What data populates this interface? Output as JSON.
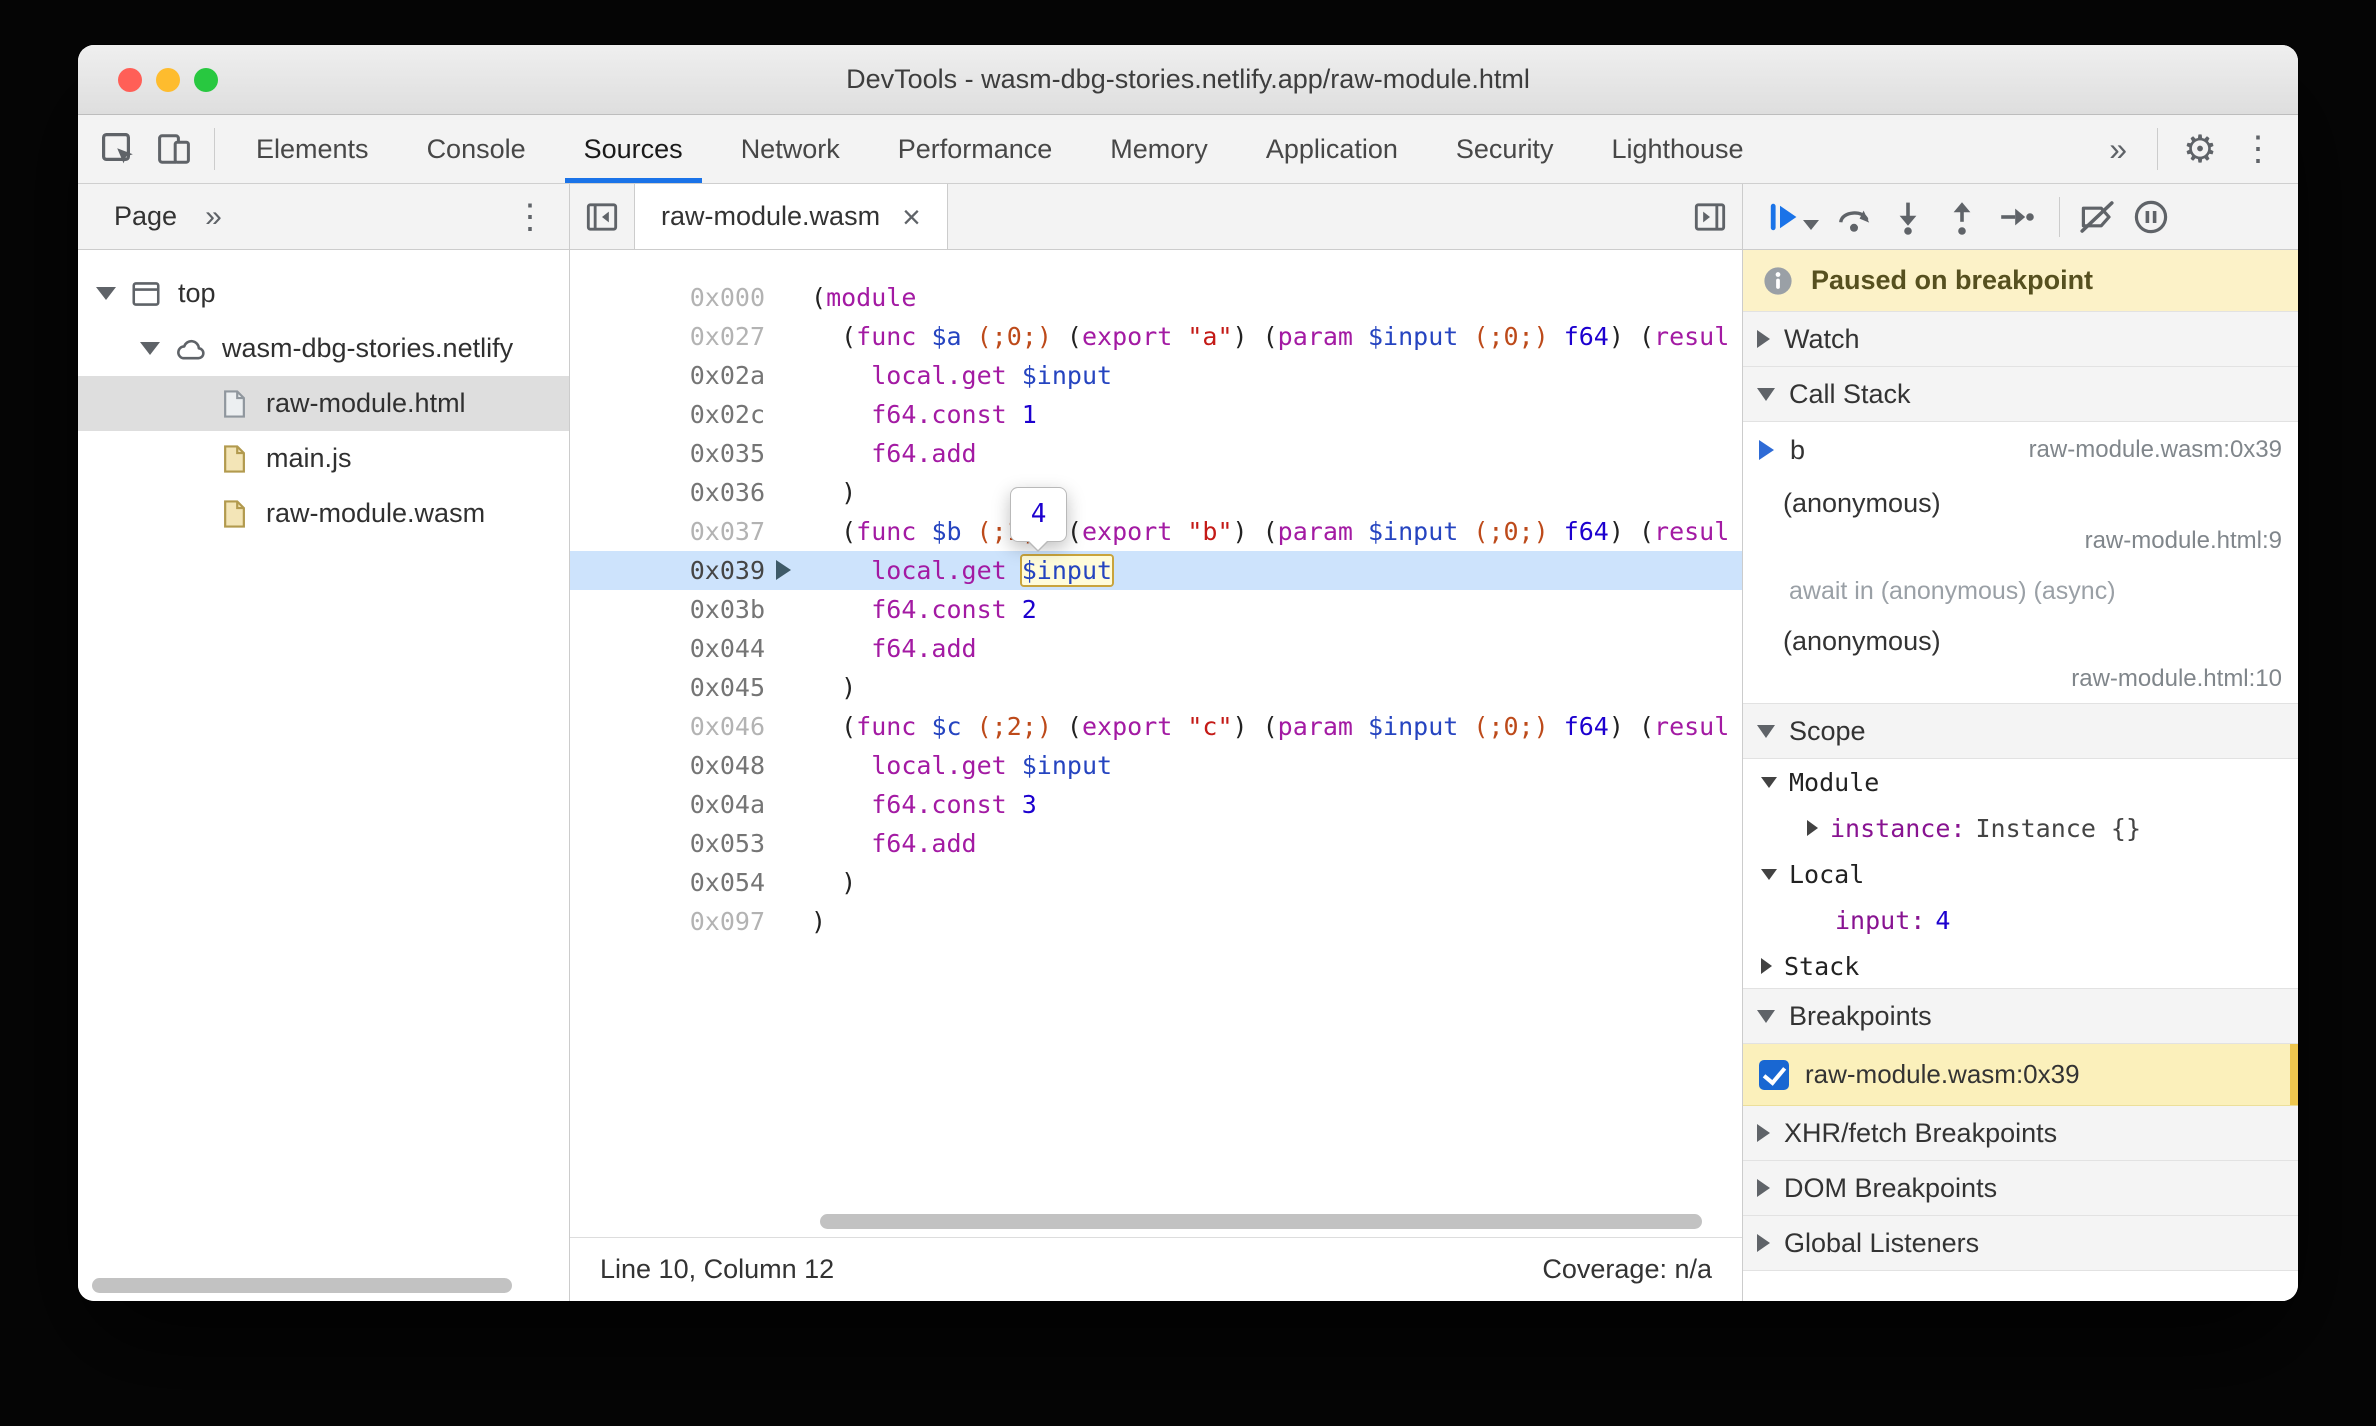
{
  "window": {
    "title": "DevTools - wasm-dbg-stories.netlify.app/raw-module.html",
    "traffic_lights": [
      "#ff5f57",
      "#febc2e",
      "#28c840"
    ]
  },
  "icon_glyphs": {
    "gear": "⚙",
    "kebab": "⋮"
  },
  "colors": {
    "accent": "#1a73e8",
    "current_line": "#cde3fc",
    "paused_banner": "#fcf2c8",
    "breakpoint_row": "#fbf0bb"
  },
  "main_toolbar": {
    "tabs": [
      {
        "label": "Elements",
        "active": false
      },
      {
        "label": "Console",
        "active": false
      },
      {
        "label": "Sources",
        "active": true
      },
      {
        "label": "Network",
        "active": false
      },
      {
        "label": "Performance",
        "active": false
      },
      {
        "label": "Memory",
        "active": false
      },
      {
        "label": "Application",
        "active": false
      },
      {
        "label": "Security",
        "active": false
      },
      {
        "label": "Lighthouse",
        "active": false
      }
    ],
    "more_tabs_label": "»"
  },
  "navigator": {
    "tab_label": "Page",
    "more_label": "»",
    "tree": [
      {
        "label": "top",
        "icon": "frame",
        "depth": 0,
        "expanded": true,
        "selected": false
      },
      {
        "label": "wasm-dbg-stories.netlify",
        "icon": "cloud",
        "depth": 1,
        "expanded": true,
        "selected": false
      },
      {
        "label": "raw-module.html",
        "icon": "doc-html",
        "depth": 2,
        "selected": true
      },
      {
        "label": "main.js",
        "icon": "doc-script",
        "depth": 2,
        "selected": false
      },
      {
        "label": "raw-module.wasm",
        "icon": "doc-script",
        "depth": 2,
        "selected": false
      }
    ]
  },
  "editor": {
    "tab_label": "raw-module.wasm",
    "close_label": "×",
    "tooltip_value": "4",
    "status_left": "Line 10, Column 12",
    "status_right": "Coverage: n/a",
    "lines": [
      {
        "addr": "0x000",
        "dim": true,
        "tokens": [
          {
            "t": "(",
            "c": "pl"
          },
          {
            "t": "module",
            "c": "kw"
          }
        ]
      },
      {
        "addr": "0x027",
        "dim": true,
        "tokens": [
          {
            "t": "  (",
            "c": "pl"
          },
          {
            "t": "func",
            "c": "kw"
          },
          {
            "t": " ",
            "c": "pl"
          },
          {
            "t": "$a",
            "c": "var"
          },
          {
            "t": " ",
            "c": "pl"
          },
          {
            "t": "(;0;)",
            "c": "cmt"
          },
          {
            "t": " (",
            "c": "pl"
          },
          {
            "t": "export",
            "c": "kw"
          },
          {
            "t": " ",
            "c": "pl"
          },
          {
            "t": "\"a\"",
            "c": "str"
          },
          {
            "t": ") (",
            "c": "pl"
          },
          {
            "t": "param",
            "c": "kw"
          },
          {
            "t": " ",
            "c": "pl"
          },
          {
            "t": "$input",
            "c": "var"
          },
          {
            "t": " ",
            "c": "pl"
          },
          {
            "t": "(;0;)",
            "c": "cmt"
          },
          {
            "t": " ",
            "c": "pl"
          },
          {
            "t": "f64",
            "c": "typ"
          },
          {
            "t": ") (",
            "c": "pl"
          },
          {
            "t": "resul",
            "c": "kw"
          }
        ]
      },
      {
        "addr": "0x02a",
        "tokens": [
          {
            "t": "    ",
            "c": "pl"
          },
          {
            "t": "local.get",
            "c": "kw"
          },
          {
            "t": " ",
            "c": "pl"
          },
          {
            "t": "$input",
            "c": "var"
          }
        ]
      },
      {
        "addr": "0x02c",
        "tokens": [
          {
            "t": "    ",
            "c": "pl"
          },
          {
            "t": "f64.const",
            "c": "kw"
          },
          {
            "t": " ",
            "c": "pl"
          },
          {
            "t": "1",
            "c": "num"
          }
        ]
      },
      {
        "addr": "0x035",
        "tokens": [
          {
            "t": "    ",
            "c": "pl"
          },
          {
            "t": "f64.add",
            "c": "kw"
          }
        ]
      },
      {
        "addr": "0x036",
        "tokens": [
          {
            "t": "  )",
            "c": "pl"
          }
        ]
      },
      {
        "addr": "0x037",
        "dim": true,
        "tokens": [
          {
            "t": "  (",
            "c": "pl"
          },
          {
            "t": "func",
            "c": "kw"
          },
          {
            "t": " ",
            "c": "pl"
          },
          {
            "t": "$b",
            "c": "var"
          },
          {
            "t": " ",
            "c": "pl"
          },
          {
            "t": "(;1;)",
            "c": "cmt"
          },
          {
            "t": " (",
            "c": "pl"
          },
          {
            "t": "export",
            "c": "kw"
          },
          {
            "t": " ",
            "c": "pl"
          },
          {
            "t": "\"b\"",
            "c": "str"
          },
          {
            "t": ") (",
            "c": "pl"
          },
          {
            "t": "param",
            "c": "kw"
          },
          {
            "t": " ",
            "c": "pl"
          },
          {
            "t": "$input",
            "c": "var"
          },
          {
            "t": " ",
            "c": "pl"
          },
          {
            "t": "(;0;)",
            "c": "cmt"
          },
          {
            "t": " ",
            "c": "pl"
          },
          {
            "t": "f64",
            "c": "typ"
          },
          {
            "t": ") (",
            "c": "pl"
          },
          {
            "t": "resul",
            "c": "kw"
          }
        ]
      },
      {
        "addr": "0x039",
        "current": true,
        "tokens": [
          {
            "t": "    ",
            "c": "pl"
          },
          {
            "t": "local.get",
            "c": "kw"
          },
          {
            "t": " ",
            "c": "pl"
          },
          {
            "t": "$input",
            "c": "var",
            "boxed": true
          }
        ]
      },
      {
        "addr": "0x03b",
        "tokens": [
          {
            "t": "    ",
            "c": "pl"
          },
          {
            "t": "f64.const",
            "c": "kw"
          },
          {
            "t": " ",
            "c": "pl"
          },
          {
            "t": "2",
            "c": "num"
          }
        ]
      },
      {
        "addr": "0x044",
        "tokens": [
          {
            "t": "    ",
            "c": "pl"
          },
          {
            "t": "f64.add",
            "c": "kw"
          }
        ]
      },
      {
        "addr": "0x045",
        "tokens": [
          {
            "t": "  )",
            "c": "pl"
          }
        ]
      },
      {
        "addr": "0x046",
        "dim": true,
        "tokens": [
          {
            "t": "  (",
            "c": "pl"
          },
          {
            "t": "func",
            "c": "kw"
          },
          {
            "t": " ",
            "c": "pl"
          },
          {
            "t": "$c",
            "c": "var"
          },
          {
            "t": " ",
            "c": "pl"
          },
          {
            "t": "(;2;)",
            "c": "cmt"
          },
          {
            "t": " (",
            "c": "pl"
          },
          {
            "t": "export",
            "c": "kw"
          },
          {
            "t": " ",
            "c": "pl"
          },
          {
            "t": "\"c\"",
            "c": "str"
          },
          {
            "t": ") (",
            "c": "pl"
          },
          {
            "t": "param",
            "c": "kw"
          },
          {
            "t": " ",
            "c": "pl"
          },
          {
            "t": "$input",
            "c": "var"
          },
          {
            "t": " ",
            "c": "pl"
          },
          {
            "t": "(;0;)",
            "c": "cmt"
          },
          {
            "t": " ",
            "c": "pl"
          },
          {
            "t": "f64",
            "c": "typ"
          },
          {
            "t": ") (",
            "c": "pl"
          },
          {
            "t": "resul",
            "c": "kw"
          }
        ]
      },
      {
        "addr": "0x048",
        "tokens": [
          {
            "t": "    ",
            "c": "pl"
          },
          {
            "t": "local.get",
            "c": "kw"
          },
          {
            "t": " ",
            "c": "pl"
          },
          {
            "t": "$input",
            "c": "var"
          }
        ]
      },
      {
        "addr": "0x04a",
        "tokens": [
          {
            "t": "    ",
            "c": "pl"
          },
          {
            "t": "f64.const",
            "c": "kw"
          },
          {
            "t": " ",
            "c": "pl"
          },
          {
            "t": "3",
            "c": "num"
          }
        ]
      },
      {
        "addr": "0x053",
        "tokens": [
          {
            "t": "    ",
            "c": "pl"
          },
          {
            "t": "f64.add",
            "c": "kw"
          }
        ]
      },
      {
        "addr": "0x054",
        "tokens": [
          {
            "t": "  )",
            "c": "pl"
          }
        ]
      },
      {
        "addr": "0x097",
        "dim": true,
        "tokens": [
          {
            "t": ")",
            "c": "pl"
          }
        ]
      }
    ]
  },
  "debugger": {
    "paused_message": "Paused on breakpoint",
    "watch_label": "Watch",
    "call_stack": {
      "label": "Call Stack",
      "frames": [
        {
          "name": "b",
          "location": "raw-module.wasm:0x39",
          "current": true
        },
        {
          "name": "(anonymous)",
          "location": "raw-module.html:9"
        },
        {
          "name": "(anonymous)",
          "location": "raw-module.html:10"
        }
      ],
      "async_separator": "await in (anonymous) (async)"
    },
    "scope": {
      "label": "Scope",
      "module_label": "Module",
      "instance_name": "instance:",
      "instance_value": "Instance {}",
      "local_label": "Local",
      "input_name": "input:",
      "input_value": "4",
      "stack_label": "Stack"
    },
    "breakpoints": {
      "label": "Breakpoints",
      "items": [
        {
          "label": "raw-module.wasm:0x39",
          "checked": true
        }
      ]
    },
    "xhr_label": "XHR/fetch Breakpoints",
    "dom_label": "DOM Breakpoints",
    "global_label": "Global Listeners"
  }
}
